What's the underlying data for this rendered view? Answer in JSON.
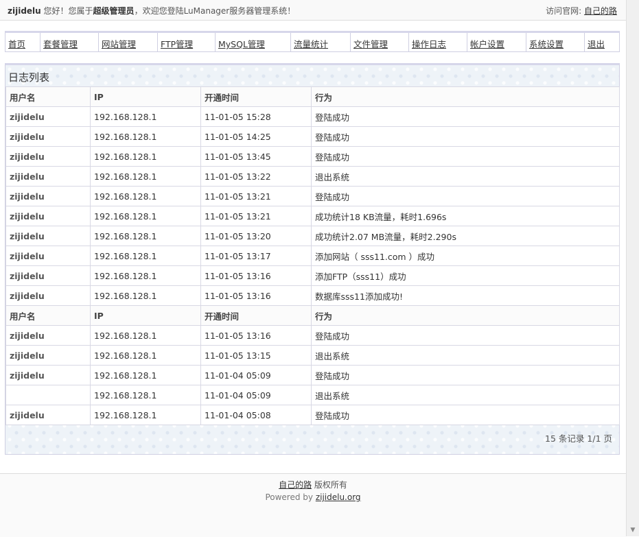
{
  "topbar": {
    "username": "zijidelu",
    "greeting_pre": " 您好！您属于",
    "role": "超级管理员",
    "greeting_post": "，欢迎您登陆LuManager服务器管理系统！",
    "visit_label": "访问官网: ",
    "visit_link": "自己的路"
  },
  "nav": [
    {
      "label": "首页"
    },
    {
      "label": "套餐管理"
    },
    {
      "label": "网站管理"
    },
    {
      "label": "FTP管理"
    },
    {
      "label": "MySQL管理"
    },
    {
      "label": "流量统计"
    },
    {
      "label": "文件管理"
    },
    {
      "label": "操作日志"
    },
    {
      "label": "帐户设置"
    },
    {
      "label": "系统设置"
    },
    {
      "label": "退出"
    }
  ],
  "log": {
    "title": "日志列表",
    "headers": [
      "用户名",
      "IP",
      "开通时间",
      "行为"
    ],
    "rows": [
      {
        "user": "zijidelu",
        "ip": "192.168.128.1",
        "time": "11-01-05 15:28",
        "action": "登陆成功"
      },
      {
        "user": "zijidelu",
        "ip": "192.168.128.1",
        "time": "11-01-05 14:25",
        "action": "登陆成功"
      },
      {
        "user": "zijidelu",
        "ip": "192.168.128.1",
        "time": "11-01-05 13:45",
        "action": "登陆成功"
      },
      {
        "user": "zijidelu",
        "ip": "192.168.128.1",
        "time": "11-01-05 13:22",
        "action": "退出系统"
      },
      {
        "user": "zijidelu",
        "ip": "192.168.128.1",
        "time": "11-01-05 13:21",
        "action": "登陆成功"
      },
      {
        "user": "zijidelu",
        "ip": "192.168.128.1",
        "time": "11-01-05 13:21",
        "action": "成功统计18 KB流量，耗时1.696s"
      },
      {
        "user": "zijidelu",
        "ip": "192.168.128.1",
        "time": "11-01-05 13:20",
        "action": "成功统计2.07 MB流量，耗时2.290s"
      },
      {
        "user": "zijidelu",
        "ip": "192.168.128.1",
        "time": "11-01-05 13:17",
        "action": "添加网站（ sss11.com ）成功"
      },
      {
        "user": "zijidelu",
        "ip": "192.168.128.1",
        "time": "11-01-05 13:16",
        "action": "添加FTP（sss11）成功"
      },
      {
        "user": "zijidelu",
        "ip": "192.168.128.1",
        "time": "11-01-05 13:16",
        "action": "数据库sss11添加成功!"
      },
      {
        "header": true
      },
      {
        "user": "zijidelu",
        "ip": "192.168.128.1",
        "time": "11-01-05 13:16",
        "action": "登陆成功"
      },
      {
        "user": "zijidelu",
        "ip": "192.168.128.1",
        "time": "11-01-05 13:15",
        "action": "退出系统"
      },
      {
        "user": "zijidelu",
        "ip": "192.168.128.1",
        "time": "11-01-04 05:09",
        "action": "登陆成功"
      },
      {
        "user": "",
        "ip": "192.168.128.1",
        "time": "11-01-04 05:09",
        "action": "退出系统"
      },
      {
        "user": "zijidelu",
        "ip": "192.168.128.1",
        "time": "11-01-04 05:08",
        "action": "登陆成功"
      }
    ],
    "pager": "15 条记录  1/1 页"
  },
  "footer": {
    "link": "自己的路",
    "rights": " 版权所有",
    "powered_label": "Powered by ",
    "powered_link": "zijidelu.org"
  }
}
